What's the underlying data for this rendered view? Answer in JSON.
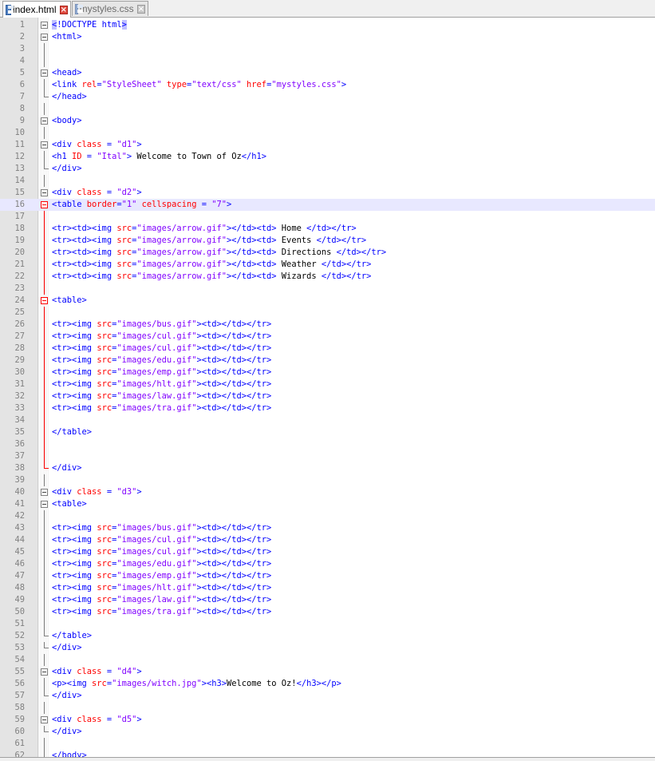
{
  "tabs": [
    {
      "label": "index.html",
      "active": true,
      "icon": "save-icon"
    },
    {
      "label": "mystyles.css",
      "active": false,
      "icon": "save-icon"
    }
  ],
  "colors": {
    "tag": "#0000ff",
    "attribute": "#ff0000",
    "string": "#8000ff",
    "text": "#000000",
    "current_line": "#e8e8ff"
  },
  "current_line": 16,
  "lines": [
    {
      "n": "1",
      "fold": "box",
      "tokens": [
        {
          "c": "t",
          "v": "<"
        },
        {
          "c": "t",
          "v": "!DOCTYPE html"
        },
        {
          "c": "t",
          "v": ">"
        }
      ]
    },
    {
      "n": "2",
      "fold": "box",
      "tokens": [
        {
          "c": "t",
          "v": "<html>"
        }
      ]
    },
    {
      "n": "3",
      "fold": "line",
      "tokens": []
    },
    {
      "n": "4",
      "fold": "line",
      "tokens": []
    },
    {
      "n": "5",
      "fold": "box",
      "tokens": [
        {
          "c": "t",
          "v": "<head>"
        }
      ]
    },
    {
      "n": "6",
      "fold": "line",
      "tokens": [
        {
          "c": "t",
          "v": "<link "
        },
        {
          "c": "a",
          "v": "rel"
        },
        {
          "c": "t",
          "v": "="
        },
        {
          "c": "s",
          "v": "\"StyleSheet\""
        },
        {
          "c": "a",
          "v": " type"
        },
        {
          "c": "t",
          "v": "="
        },
        {
          "c": "s",
          "v": "\"text/css\""
        },
        {
          "c": "a",
          "v": " href"
        },
        {
          "c": "t",
          "v": "="
        },
        {
          "c": "s",
          "v": "\"mystyles.css\""
        },
        {
          "c": "t",
          "v": ">"
        }
      ]
    },
    {
      "n": "7",
      "fold": "end",
      "tokens": [
        {
          "c": "t",
          "v": "</head>"
        }
      ]
    },
    {
      "n": "8",
      "fold": "line",
      "tokens": []
    },
    {
      "n": "9",
      "fold": "box",
      "tokens": [
        {
          "c": "t",
          "v": "<body>"
        }
      ]
    },
    {
      "n": "10",
      "fold": "line",
      "tokens": []
    },
    {
      "n": "11",
      "fold": "box",
      "tokens": [
        {
          "c": "t",
          "v": "<div "
        },
        {
          "c": "a",
          "v": "class"
        },
        {
          "c": "t",
          "v": " = "
        },
        {
          "c": "s",
          "v": "\"d1\""
        },
        {
          "c": "t",
          "v": ">"
        }
      ]
    },
    {
      "n": "12",
      "fold": "line",
      "tokens": [
        {
          "c": "t",
          "v": "<h1 "
        },
        {
          "c": "a",
          "v": "ID"
        },
        {
          "c": "t",
          "v": " = "
        },
        {
          "c": "s",
          "v": "\"Ital\""
        },
        {
          "c": "t",
          "v": ">"
        },
        {
          "c": "x",
          "v": " Welcome to Town of Oz"
        },
        {
          "c": "t",
          "v": "</h1>"
        }
      ]
    },
    {
      "n": "13",
      "fold": "end",
      "tokens": [
        {
          "c": "t",
          "v": "</div>"
        }
      ]
    },
    {
      "n": "14",
      "fold": "line",
      "tokens": []
    },
    {
      "n": "15",
      "fold": "box",
      "tokens": [
        {
          "c": "t",
          "v": "<div "
        },
        {
          "c": "a",
          "v": "class"
        },
        {
          "c": "t",
          "v": " = "
        },
        {
          "c": "s",
          "v": "\"d2\""
        },
        {
          "c": "t",
          "v": ">"
        }
      ]
    },
    {
      "n": "16",
      "fold": "boxred",
      "tokens": [
        {
          "c": "t",
          "v": "<table "
        },
        {
          "c": "a",
          "v": "border"
        },
        {
          "c": "t",
          "v": "="
        },
        {
          "c": "s",
          "v": "\"1\""
        },
        {
          "c": "a",
          "v": " cellspacing"
        },
        {
          "c": "t",
          "v": " = "
        },
        {
          "c": "s",
          "v": "\"7\""
        },
        {
          "c": "t",
          "v": ">"
        }
      ]
    },
    {
      "n": "17",
      "fold": "linered",
      "tokens": []
    },
    {
      "n": "18",
      "fold": "linered",
      "tokens": [
        {
          "c": "t",
          "v": "<tr><td><img "
        },
        {
          "c": "a",
          "v": "src"
        },
        {
          "c": "t",
          "v": "="
        },
        {
          "c": "s",
          "v": "\"images/arrow.gif\""
        },
        {
          "c": "t",
          "v": "></td><td>"
        },
        {
          "c": "x",
          "v": " Home "
        },
        {
          "c": "t",
          "v": "</td></tr>"
        }
      ]
    },
    {
      "n": "19",
      "fold": "linered",
      "tokens": [
        {
          "c": "t",
          "v": "<tr><td><img "
        },
        {
          "c": "a",
          "v": "src"
        },
        {
          "c": "t",
          "v": "="
        },
        {
          "c": "s",
          "v": "\"images/arrow.gif\""
        },
        {
          "c": "t",
          "v": "></td><td>"
        },
        {
          "c": "x",
          "v": " Events "
        },
        {
          "c": "t",
          "v": "</td></tr>"
        }
      ]
    },
    {
      "n": "20",
      "fold": "linered",
      "tokens": [
        {
          "c": "t",
          "v": "<tr><td><img "
        },
        {
          "c": "a",
          "v": "src"
        },
        {
          "c": "t",
          "v": "="
        },
        {
          "c": "s",
          "v": "\"images/arrow.gif\""
        },
        {
          "c": "t",
          "v": "></td><td>"
        },
        {
          "c": "x",
          "v": " Directions "
        },
        {
          "c": "t",
          "v": "</td></tr>"
        }
      ]
    },
    {
      "n": "21",
      "fold": "linered",
      "tokens": [
        {
          "c": "t",
          "v": "<tr><td><img "
        },
        {
          "c": "a",
          "v": "src"
        },
        {
          "c": "t",
          "v": "="
        },
        {
          "c": "s",
          "v": "\"images/arrow.gif\""
        },
        {
          "c": "t",
          "v": "></td><td>"
        },
        {
          "c": "x",
          "v": " Weather "
        },
        {
          "c": "t",
          "v": "</td></tr>"
        }
      ]
    },
    {
      "n": "22",
      "fold": "linered",
      "tokens": [
        {
          "c": "t",
          "v": "<tr><td><img "
        },
        {
          "c": "a",
          "v": "src"
        },
        {
          "c": "t",
          "v": "="
        },
        {
          "c": "s",
          "v": "\"images/arrow.gif\""
        },
        {
          "c": "t",
          "v": "></td><td>"
        },
        {
          "c": "x",
          "v": " Wizards "
        },
        {
          "c": "t",
          "v": "</td></tr>"
        }
      ]
    },
    {
      "n": "23",
      "fold": "linered",
      "tokens": []
    },
    {
      "n": "24",
      "fold": "boxred",
      "tokens": [
        {
          "c": "t",
          "v": "<table>"
        }
      ]
    },
    {
      "n": "25",
      "fold": "linered",
      "tokens": []
    },
    {
      "n": "26",
      "fold": "linered",
      "tokens": [
        {
          "c": "t",
          "v": "<tr><img "
        },
        {
          "c": "a",
          "v": "src"
        },
        {
          "c": "t",
          "v": "="
        },
        {
          "c": "s",
          "v": "\"images/bus.gif\""
        },
        {
          "c": "t",
          "v": "><td></td></tr>"
        }
      ]
    },
    {
      "n": "27",
      "fold": "linered",
      "tokens": [
        {
          "c": "t",
          "v": "<tr><img "
        },
        {
          "c": "a",
          "v": "src"
        },
        {
          "c": "t",
          "v": "="
        },
        {
          "c": "s",
          "v": "\"images/cul.gif\""
        },
        {
          "c": "t",
          "v": "><td></td></tr>"
        }
      ]
    },
    {
      "n": "28",
      "fold": "linered",
      "tokens": [
        {
          "c": "t",
          "v": "<tr><img "
        },
        {
          "c": "a",
          "v": "src"
        },
        {
          "c": "t",
          "v": "="
        },
        {
          "c": "s",
          "v": "\"images/cul.gif\""
        },
        {
          "c": "t",
          "v": "><td></td></tr>"
        }
      ]
    },
    {
      "n": "29",
      "fold": "linered",
      "tokens": [
        {
          "c": "t",
          "v": "<tr><img "
        },
        {
          "c": "a",
          "v": "src"
        },
        {
          "c": "t",
          "v": "="
        },
        {
          "c": "s",
          "v": "\"images/edu.gif\""
        },
        {
          "c": "t",
          "v": "><td></td></tr>"
        }
      ]
    },
    {
      "n": "30",
      "fold": "linered",
      "tokens": [
        {
          "c": "t",
          "v": "<tr><img "
        },
        {
          "c": "a",
          "v": "src"
        },
        {
          "c": "t",
          "v": "="
        },
        {
          "c": "s",
          "v": "\"images/emp.gif\""
        },
        {
          "c": "t",
          "v": "><td></td></tr>"
        }
      ]
    },
    {
      "n": "31",
      "fold": "linered",
      "tokens": [
        {
          "c": "t",
          "v": "<tr><img "
        },
        {
          "c": "a",
          "v": "src"
        },
        {
          "c": "t",
          "v": "="
        },
        {
          "c": "s",
          "v": "\"images/hlt.gif\""
        },
        {
          "c": "t",
          "v": "><td></td></tr>"
        }
      ]
    },
    {
      "n": "32",
      "fold": "linered",
      "tokens": [
        {
          "c": "t",
          "v": "<tr><img "
        },
        {
          "c": "a",
          "v": "src"
        },
        {
          "c": "t",
          "v": "="
        },
        {
          "c": "s",
          "v": "\"images/law.gif\""
        },
        {
          "c": "t",
          "v": "><td></td></tr>"
        }
      ]
    },
    {
      "n": "33",
      "fold": "linered",
      "tokens": [
        {
          "c": "t",
          "v": "<tr><img "
        },
        {
          "c": "a",
          "v": "src"
        },
        {
          "c": "t",
          "v": "="
        },
        {
          "c": "s",
          "v": "\"images/tra.gif\""
        },
        {
          "c": "t",
          "v": "><td></td></tr>"
        }
      ]
    },
    {
      "n": "34",
      "fold": "linered",
      "tokens": []
    },
    {
      "n": "35",
      "fold": "linered",
      "tokens": [
        {
          "c": "t",
          "v": "</table>"
        }
      ]
    },
    {
      "n": "36",
      "fold": "linered",
      "tokens": []
    },
    {
      "n": "37",
      "fold": "linered",
      "tokens": []
    },
    {
      "n": "38",
      "fold": "endred",
      "tokens": [
        {
          "c": "t",
          "v": "</div>"
        }
      ]
    },
    {
      "n": "39",
      "fold": "line",
      "tokens": []
    },
    {
      "n": "40",
      "fold": "box",
      "tokens": [
        {
          "c": "t",
          "v": "<div "
        },
        {
          "c": "a",
          "v": "class"
        },
        {
          "c": "t",
          "v": " = "
        },
        {
          "c": "s",
          "v": "\"d3\""
        },
        {
          "c": "t",
          "v": ">"
        }
      ]
    },
    {
      "n": "41",
      "fold": "box",
      "tokens": [
        {
          "c": "t",
          "v": "<table>"
        }
      ]
    },
    {
      "n": "42",
      "fold": "line",
      "tokens": []
    },
    {
      "n": "43",
      "fold": "line",
      "tokens": [
        {
          "c": "t",
          "v": "<tr><img "
        },
        {
          "c": "a",
          "v": "src"
        },
        {
          "c": "t",
          "v": "="
        },
        {
          "c": "s",
          "v": "\"images/bus.gif\""
        },
        {
          "c": "t",
          "v": "><td></td></tr>"
        }
      ]
    },
    {
      "n": "44",
      "fold": "line",
      "tokens": [
        {
          "c": "t",
          "v": "<tr><img "
        },
        {
          "c": "a",
          "v": "src"
        },
        {
          "c": "t",
          "v": "="
        },
        {
          "c": "s",
          "v": "\"images/cul.gif\""
        },
        {
          "c": "t",
          "v": "><td></td></tr>"
        }
      ]
    },
    {
      "n": "45",
      "fold": "line",
      "tokens": [
        {
          "c": "t",
          "v": "<tr><img "
        },
        {
          "c": "a",
          "v": "src"
        },
        {
          "c": "t",
          "v": "="
        },
        {
          "c": "s",
          "v": "\"images/cul.gif\""
        },
        {
          "c": "t",
          "v": "><td></td></tr>"
        }
      ]
    },
    {
      "n": "46",
      "fold": "line",
      "tokens": [
        {
          "c": "t",
          "v": "<tr><img "
        },
        {
          "c": "a",
          "v": "src"
        },
        {
          "c": "t",
          "v": "="
        },
        {
          "c": "s",
          "v": "\"images/edu.gif\""
        },
        {
          "c": "t",
          "v": "><td></td></tr>"
        }
      ]
    },
    {
      "n": "47",
      "fold": "line",
      "tokens": [
        {
          "c": "t",
          "v": "<tr><img "
        },
        {
          "c": "a",
          "v": "src"
        },
        {
          "c": "t",
          "v": "="
        },
        {
          "c": "s",
          "v": "\"images/emp.gif\""
        },
        {
          "c": "t",
          "v": "><td></td></tr>"
        }
      ]
    },
    {
      "n": "48",
      "fold": "line",
      "tokens": [
        {
          "c": "t",
          "v": "<tr><img "
        },
        {
          "c": "a",
          "v": "src"
        },
        {
          "c": "t",
          "v": "="
        },
        {
          "c": "s",
          "v": "\"images/hlt.gif\""
        },
        {
          "c": "t",
          "v": "><td></td></tr>"
        }
      ]
    },
    {
      "n": "49",
      "fold": "line",
      "tokens": [
        {
          "c": "t",
          "v": "<tr><img "
        },
        {
          "c": "a",
          "v": "src"
        },
        {
          "c": "t",
          "v": "="
        },
        {
          "c": "s",
          "v": "\"images/law.gif\""
        },
        {
          "c": "t",
          "v": "><td></td></tr>"
        }
      ]
    },
    {
      "n": "50",
      "fold": "line",
      "tokens": [
        {
          "c": "t",
          "v": "<tr><img "
        },
        {
          "c": "a",
          "v": "src"
        },
        {
          "c": "t",
          "v": "="
        },
        {
          "c": "s",
          "v": "\"images/tra.gif\""
        },
        {
          "c": "t",
          "v": "><td></td></tr>"
        }
      ]
    },
    {
      "n": "51",
      "fold": "line",
      "tokens": []
    },
    {
      "n": "52",
      "fold": "end",
      "tokens": [
        {
          "c": "t",
          "v": "</table>"
        }
      ]
    },
    {
      "n": "53",
      "fold": "end",
      "tokens": [
        {
          "c": "t",
          "v": "</div>"
        }
      ]
    },
    {
      "n": "54",
      "fold": "line",
      "tokens": []
    },
    {
      "n": "55",
      "fold": "box",
      "tokens": [
        {
          "c": "t",
          "v": "<div "
        },
        {
          "c": "a",
          "v": "class"
        },
        {
          "c": "t",
          "v": " = "
        },
        {
          "c": "s",
          "v": "\"d4\""
        },
        {
          "c": "t",
          "v": ">"
        }
      ]
    },
    {
      "n": "56",
      "fold": "line",
      "tokens": [
        {
          "c": "t",
          "v": "<p><img "
        },
        {
          "c": "a",
          "v": "src"
        },
        {
          "c": "t",
          "v": "="
        },
        {
          "c": "s",
          "v": "\"images/witch.jpg\""
        },
        {
          "c": "t",
          "v": "><h3>"
        },
        {
          "c": "x",
          "v": "Welcome to Oz!"
        },
        {
          "c": "t",
          "v": "</h3></p>"
        }
      ]
    },
    {
      "n": "57",
      "fold": "end",
      "tokens": [
        {
          "c": "t",
          "v": "</div>"
        }
      ]
    },
    {
      "n": "58",
      "fold": "line",
      "tokens": []
    },
    {
      "n": "59",
      "fold": "box",
      "tokens": [
        {
          "c": "t",
          "v": "<div "
        },
        {
          "c": "a",
          "v": "class"
        },
        {
          "c": "t",
          "v": " = "
        },
        {
          "c": "s",
          "v": "\"d5\""
        },
        {
          "c": "t",
          "v": ">"
        }
      ]
    },
    {
      "n": "60",
      "fold": "end",
      "tokens": [
        {
          "c": "t",
          "v": "</div>"
        }
      ]
    },
    {
      "n": "61",
      "fold": "line",
      "tokens": []
    },
    {
      "n": "62",
      "fold": "line",
      "tokens": [
        {
          "c": "t",
          "v": "</body>"
        }
      ]
    }
  ]
}
